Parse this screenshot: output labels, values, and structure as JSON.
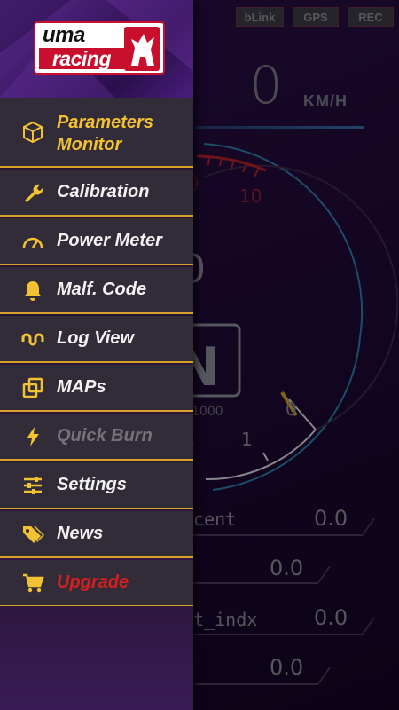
{
  "status": {
    "blink": "bLink",
    "gps": "GPS",
    "rec": "REC"
  },
  "speed": {
    "value": "0",
    "unit": "KM/H"
  },
  "gauge": {
    "tick_labels": [
      "9",
      "10",
      "0",
      "1",
      "1000",
      "2"
    ],
    "reading": "0",
    "gear": "N"
  },
  "dash_rows": [
    {
      "label": "rcent",
      "value": "0.0"
    },
    {
      "label": "",
      "value": "0.0"
    },
    {
      "label": "ct_indx",
      "value": "0.0"
    },
    {
      "label": "",
      "value": "0.0"
    }
  ],
  "drawer": {
    "logo": {
      "line1": "uma",
      "line2": "racing"
    },
    "items": [
      {
        "label_line1": "Parameters",
        "label_line2": "Monitor",
        "icon": "cube-outline-icon",
        "state": "active"
      },
      {
        "label": "Calibration",
        "icon": "wrench-icon",
        "state": "normal"
      },
      {
        "label": "Power Meter",
        "icon": "speedometer-icon",
        "state": "normal"
      },
      {
        "label": "Malf. Code",
        "icon": "bell-icon",
        "state": "normal"
      },
      {
        "label": "Log View",
        "icon": "log-wave-icon",
        "state": "normal"
      },
      {
        "label": "MAPs",
        "icon": "copy-squares-icon",
        "state": "normal"
      },
      {
        "label": "Quick Burn",
        "icon": "lightning-icon",
        "state": "disabled"
      },
      {
        "label": "Settings",
        "icon": "sliders-icon",
        "state": "normal"
      },
      {
        "label": "News",
        "icon": "tags-icon",
        "state": "normal"
      },
      {
        "label": "Upgrade",
        "icon": "cart-icon",
        "state": "highlight"
      }
    ]
  },
  "colors": {
    "accent": "#F3C233",
    "divider": "#D8A12A",
    "upgrade": "#D1201F",
    "brand_red": "#C8102E"
  }
}
